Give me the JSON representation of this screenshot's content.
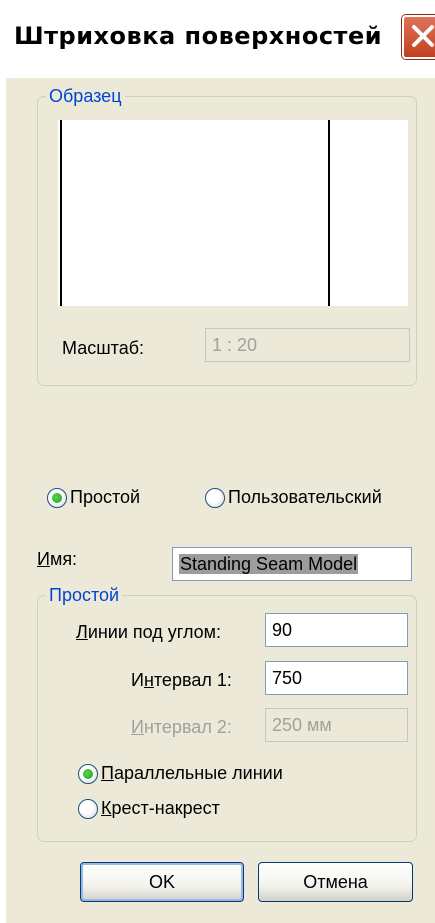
{
  "window": {
    "title": "Штриховка поверхностей",
    "close_icon": "close-icon"
  },
  "sample": {
    "legend": "Образец",
    "scale_label": "Масштаб:",
    "scale_value": "1 : 20"
  },
  "hatch_type": {
    "simple_label": "Простой",
    "custom_label": "Пользовательский",
    "selected": "simple"
  },
  "name": {
    "label": "Имя:",
    "label_accel": "И",
    "label_rest": "мя:",
    "value": "Standing Seam Model"
  },
  "simple": {
    "legend": "Простой",
    "angle": {
      "label": "Линии под углом:",
      "accel": "Л",
      "rest": "инии под углом:",
      "value": "90"
    },
    "interval1": {
      "label": "Интервал 1:",
      "pre": "И",
      "accel": "н",
      "rest": "тервал 1:",
      "value": "750"
    },
    "interval2": {
      "label": "Интервал 2:",
      "accel": "И",
      "rest": "нтервал 2:",
      "value": "250 мм"
    },
    "parallel": {
      "label": "Параллельные линии",
      "accel": "П",
      "rest": "араллельные линии"
    },
    "crosshatch": {
      "label": "Крест-накрест",
      "accel": "К",
      "rest": "рест-накрест"
    },
    "selected": "parallel"
  },
  "buttons": {
    "ok": "OK",
    "cancel": "Отмена"
  },
  "colors": {
    "group_legend": "#0046d5",
    "dialog_bg": "#ece9d8",
    "close_button": "#c2401f"
  }
}
